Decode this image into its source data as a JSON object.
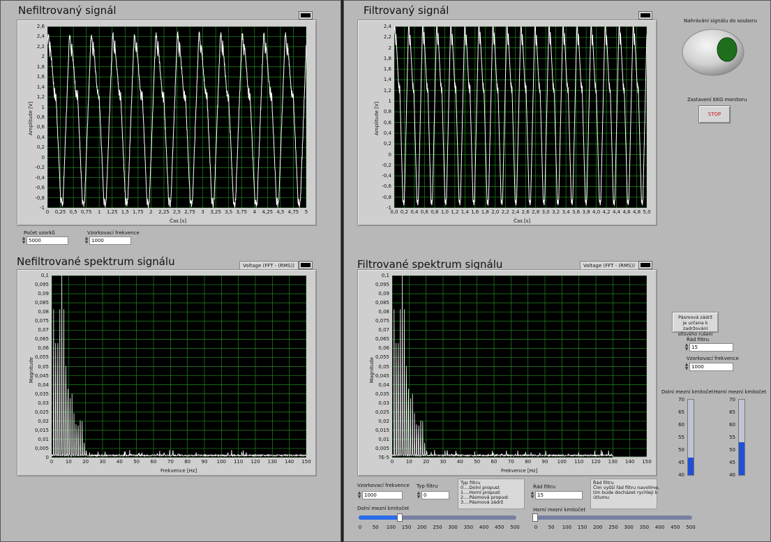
{
  "left_panel": {
    "unfiltered_signal": {
      "title": "Nefiltrovaný signál",
      "ylabel": "Amplitude [V]",
      "xlabel": "Čas  [s]",
      "yticks": [
        "2,6",
        "2,4",
        "2,2",
        "2",
        "1,8",
        "1,6",
        "1,4",
        "1,2",
        "1",
        "0,8",
        "0,6",
        "0,4",
        "0,2",
        "0",
        "-0,2",
        "-0,4",
        "-0,6",
        "-0,8",
        "-1"
      ],
      "xticks": [
        "0",
        "0,25",
        "0,5",
        "0,75",
        "1",
        "1,25",
        "1,5",
        "1,75",
        "2",
        "2,25",
        "2,5",
        "2,75",
        "3",
        "3,25",
        "3,5",
        "3,75",
        "4",
        "4,25",
        "4,5",
        "4,75",
        "5"
      ]
    },
    "sample_count": {
      "label": "Počet vzorků",
      "value": "5000"
    },
    "sampling_freq": {
      "label": "Vzorkovací frekvence",
      "value": "1000"
    },
    "unfiltered_spectrum": {
      "title": "Nefiltrované spektrum signálu",
      "legend": "Voltage (FFT - (RMS))",
      "ylabel": "Magnitude",
      "xlabel": "Frekvence  [Hz]",
      "yticks": [
        "0,1",
        "0,095",
        "0,09",
        "0,085",
        "0,08",
        "0,075",
        "0,07",
        "0,065",
        "0,06",
        "0,055",
        "0,05",
        "0,045",
        "0,04",
        "0,035",
        "0,03",
        "0,025",
        "0,02",
        "0,015",
        "0,01",
        "0,005",
        "0"
      ],
      "xticks": [
        "0",
        "10",
        "20",
        "30",
        "40",
        "50",
        "60",
        "70",
        "80",
        "90",
        "100",
        "110",
        "120",
        "130",
        "140",
        "150"
      ]
    }
  },
  "right_panel": {
    "filtered_signal": {
      "title": "Filtrovaný signál",
      "ylabel": "Amplitude [V]",
      "xlabel": "Čas  [s]",
      "yticks": [
        "2,4",
        "2,2",
        "2",
        "1,8",
        "1,6",
        "1,4",
        "1,2",
        "1",
        "0,8",
        "0,6",
        "0,4",
        "0,2",
        "0",
        "-0,2",
        "-0,4",
        "-0,6",
        "-0,8",
        "-1"
      ],
      "xticks": [
        "0,0",
        "0,2",
        "0,4",
        "0,6",
        "0,8",
        "1,0",
        "1,2",
        "1,4",
        "1,6",
        "1,8",
        "2,0",
        "2,2",
        "2,4",
        "2,6",
        "2,8",
        "3,0",
        "3,2",
        "3,4",
        "3,6",
        "3,8",
        "4,0",
        "4,2",
        "4,4",
        "4,6",
        "4,8",
        "5,0"
      ]
    },
    "load_file": {
      "label": "Nahrávání signálu do souboru"
    },
    "stop": {
      "label": "Zastavení EKG monitoru",
      "button": "STOP"
    },
    "filtered_spectrum": {
      "title": "Filtrované spektrum signálu",
      "legend": "Voltage (FFT - (RMS))",
      "ylabel": "Magnitude",
      "xlabel": "Frekvence  [Hz]",
      "yticks": [
        "0,1",
        "0,095",
        "0,09",
        "0,085",
        "0,08",
        "0,075",
        "0,07",
        "0,065",
        "0,06",
        "0,055",
        "0,05",
        "0,045",
        "0,04",
        "0,035",
        "0,03",
        "0,025",
        "0,02",
        "0,015",
        "0,01",
        "0,005",
        "7E-5"
      ],
      "xticks": [
        "0",
        "10",
        "20",
        "30",
        "40",
        "50",
        "60",
        "70",
        "80",
        "90",
        "100",
        "110",
        "120",
        "130",
        "140",
        "150"
      ]
    },
    "bandstop": {
      "button_lines": [
        "Pásmová zádrž",
        "je určena k zadržování",
        "síťového rušení"
      ],
      "order": {
        "label": "Řád filtru",
        "value": "15"
      },
      "sampling_freq": {
        "label": "Vzorkovací frekvence",
        "value": "1000"
      },
      "low_cutoff_label": "Dolní mezní kmitočet",
      "high_cutoff_label": "Horní mezní kmitočet",
      "tank_scale": [
        "70",
        "65",
        "60",
        "55",
        "50",
        "45",
        "40"
      ],
      "low_level": 47,
      "high_level": 53
    },
    "controls": {
      "sampling_freq": {
        "label": "Vzorkovací frekvence",
        "value": "1000"
      },
      "filter_type": {
        "label": "Typ filtru",
        "value": "0"
      },
      "filter_type_note": [
        "Typ filtru",
        "0....Dolní propust",
        "1....Horní propust",
        "2....Pásmová propust",
        "3....Pásmová zádrž"
      ],
      "order": {
        "label": "Řád filtru",
        "value": "15"
      },
      "order_note": [
        "Řád filtru",
        "Čím vyšší řád filtru navolíme,",
        "tím bude docházet rychleji k",
        "útlumu"
      ],
      "low_cutoff": {
        "label": "Dolní mezní kmitočet",
        "value": 130
      },
      "high_cutoff": {
        "label": "Horní mezní kmitočet",
        "value": 0
      },
      "slider_scale": [
        "0",
        "50",
        "100",
        "150",
        "200",
        "250",
        "300",
        "350",
        "400",
        "450",
        "500"
      ]
    }
  },
  "colors": {
    "plot_bg": "#000000",
    "grid": "#1f8a1f",
    "trace": "#ffffff",
    "accent": "#2a6be8",
    "stop_text": "#c0161b",
    "led": "#1e6e1e"
  }
}
